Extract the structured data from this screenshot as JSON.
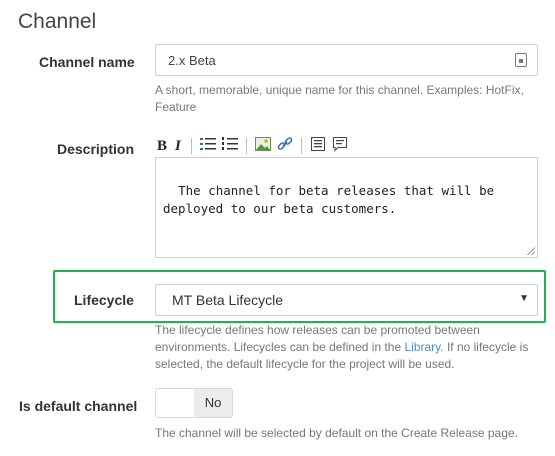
{
  "section": {
    "title": "Channel"
  },
  "channel_name": {
    "label": "Channel name",
    "value": "2.x Beta",
    "help": "A short, memorable, unique name for this channel. Examples: HotFix, Feature"
  },
  "description": {
    "label": "Description",
    "toolbar": {
      "bold": "B",
      "italic": "I"
    },
    "value": "The channel for beta releases that will be\ndeployed to our beta customers."
  },
  "lifecycle": {
    "label": "Lifecycle",
    "selected": "MT Beta Lifecycle",
    "help_part1": "The lifecycle defines how releases can be promoted between environments. Lifecycles can be defined in the ",
    "help_link": "Library",
    "help_part2": ". If no lifecycle is selected, the default lifecycle for the project will be used.",
    "highlight_color": "#20b34e"
  },
  "default_channel": {
    "label": "Is default channel",
    "toggle_value": "No",
    "help": "The channel will be selected by default on the Create Release page."
  },
  "colors": {
    "link": "#4a8bd1"
  }
}
